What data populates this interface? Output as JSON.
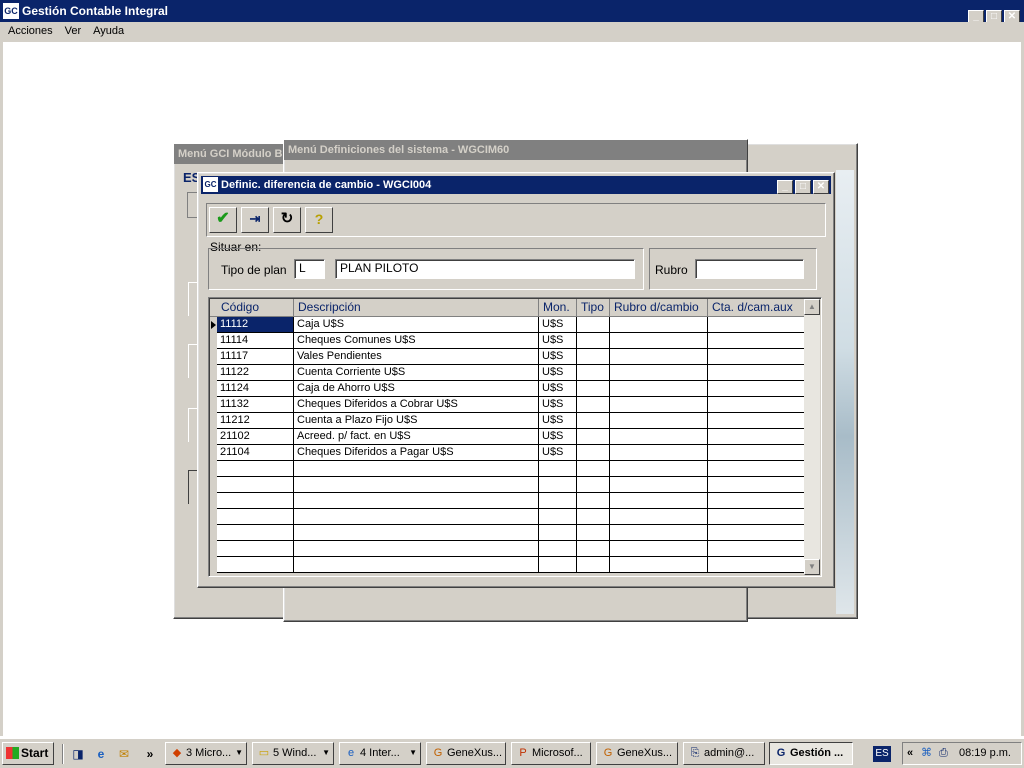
{
  "app": {
    "title": "Gestión Contable Integral",
    "menu": [
      "Acciones",
      "Ver",
      "Ayuda"
    ]
  },
  "bg_windows": {
    "modulo_title": "Menú GCI Módulo B",
    "modulo_fragment": "ES",
    "definiciones_title": "Menú Definiciones del sistema - WGCIM60"
  },
  "dialog": {
    "title": "Definic. diferencia de cambio - WGCI004",
    "toolbar": {
      "confirm_icon": "checkmark-icon",
      "exit_icon": "exit-door-icon",
      "refresh_icon": "refresh-icon",
      "help_icon": "help-question-icon"
    },
    "situar": {
      "legend": "Situar en:",
      "tipo_label": "Tipo de plan",
      "tipo_value": "L",
      "plan_desc": "PLAN PILOTO",
      "rubro_label": "Rubro",
      "rubro_value": ""
    },
    "grid": {
      "headers": [
        "Código",
        "Descripción",
        "Mon.",
        "Tipo",
        "Rubro d/cambio",
        "Cta. d/cam.aux"
      ],
      "rows": [
        {
          "codigo": "11112",
          "desc": "Caja U$S",
          "mon": "U$S",
          "tipo": "",
          "rubro": "",
          "cta": ""
        },
        {
          "codigo": "11114",
          "desc": "Cheques Comunes U$S",
          "mon": "U$S",
          "tipo": "",
          "rubro": "",
          "cta": ""
        },
        {
          "codigo": "11117",
          "desc": "Vales Pendientes",
          "mon": "U$S",
          "tipo": "",
          "rubro": "",
          "cta": ""
        },
        {
          "codigo": "11122",
          "desc": "Cuenta Corriente  U$S",
          "mon": "U$S",
          "tipo": "",
          "rubro": "",
          "cta": ""
        },
        {
          "codigo": "11124",
          "desc": "Caja de Ahorro U$S",
          "mon": "U$S",
          "tipo": "",
          "rubro": "",
          "cta": ""
        },
        {
          "codigo": "11132",
          "desc": "Cheques Diferidos a Cobrar U$S",
          "mon": "U$S",
          "tipo": "",
          "rubro": "",
          "cta": ""
        },
        {
          "codigo": "11212",
          "desc": "Cuenta a Plazo Fijo U$S",
          "mon": "U$S",
          "tipo": "",
          "rubro": "",
          "cta": ""
        },
        {
          "codigo": "21102",
          "desc": "Acreed. p/ fact. en U$S",
          "mon": "U$S",
          "tipo": "",
          "rubro": "",
          "cta": ""
        },
        {
          "codigo": "21104",
          "desc": "Cheques Diferidos a Pagar U$S",
          "mon": "U$S",
          "tipo": "",
          "rubro": "",
          "cta": ""
        }
      ],
      "empty_rows": 7
    }
  },
  "taskbar": {
    "start": "Start",
    "tasks": [
      {
        "label": "3 Micro...",
        "icon": "office-icon"
      },
      {
        "label": "5 Wind...",
        "icon": "folder-icon"
      },
      {
        "label": "4 Inter...",
        "icon": "ie-icon"
      },
      {
        "label": "GeneXus...",
        "icon": "genexus-icon"
      },
      {
        "label": "Microsof...",
        "icon": "powerpoint-icon"
      },
      {
        "label": "GeneXus...",
        "icon": "genexus-icon"
      },
      {
        "label": "admin@...",
        "icon": "remote-icon"
      },
      {
        "label": "Gestión ...",
        "icon": "gci-icon"
      }
    ],
    "lang": "ES",
    "clock": "08:19 p.m."
  },
  "colors": {
    "active_title": "#0a246a",
    "inactive_title": "#808080",
    "face": "#d4d0c8"
  }
}
